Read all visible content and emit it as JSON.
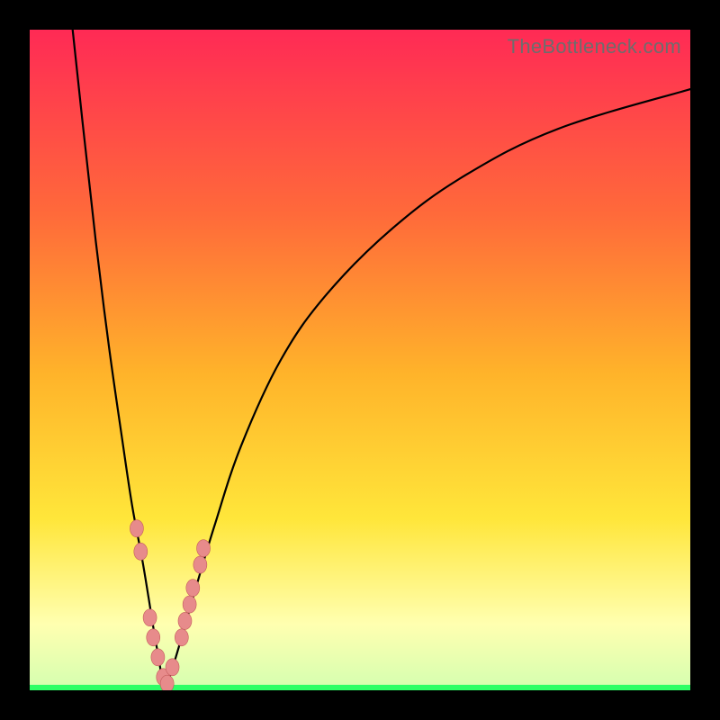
{
  "watermark": "TheBottleneck.com",
  "colors": {
    "black_frame": "#000000",
    "curve_stroke": "#000000",
    "marker_fill": "#e78b8b",
    "marker_stroke": "#c45c5c",
    "watermark_text": "#6d6d6d",
    "gradient_top": "#ff2a55",
    "gradient_upper_mid": "#ff6a3a",
    "gradient_mid": "#ffb32a",
    "gradient_lower_mid": "#ffe63a",
    "gradient_pale_yellow": "#ffffb0",
    "gradient_bottom": "#2cff66"
  },
  "chart_data": {
    "type": "line",
    "title": "",
    "xlabel": "",
    "ylabel": "",
    "xlim": [
      0,
      100
    ],
    "ylim": [
      0,
      100
    ],
    "grid": false,
    "legend": false,
    "series": [
      {
        "name": "bottleneck-curve-left",
        "x": [
          6.5,
          8,
          10,
          12,
          14,
          15.5,
          17,
          18,
          18.8,
          19.5,
          20,
          20.5
        ],
        "values": [
          100,
          86,
          68,
          52,
          38,
          28,
          20,
          14,
          9,
          5,
          2,
          0
        ]
      },
      {
        "name": "bottleneck-curve-right",
        "x": [
          20.5,
          21.5,
          23,
          25,
          28,
          32,
          38,
          45,
          55,
          66,
          80,
          100
        ],
        "values": [
          0,
          3,
          8,
          15,
          25,
          37,
          50,
          60,
          70,
          78,
          85,
          91
        ]
      }
    ],
    "markers": {
      "name": "bead-markers",
      "x": [
        16.2,
        16.8,
        18.2,
        18.7,
        19.4,
        20.2,
        20.8,
        21.6,
        23.0,
        23.5,
        24.2,
        24.7,
        25.8,
        26.3
      ],
      "values": [
        24.5,
        21.0,
        11.0,
        8.0,
        5.0,
        2.0,
        1.0,
        3.5,
        8.0,
        10.5,
        13.0,
        15.5,
        19.0,
        21.5
      ]
    }
  }
}
